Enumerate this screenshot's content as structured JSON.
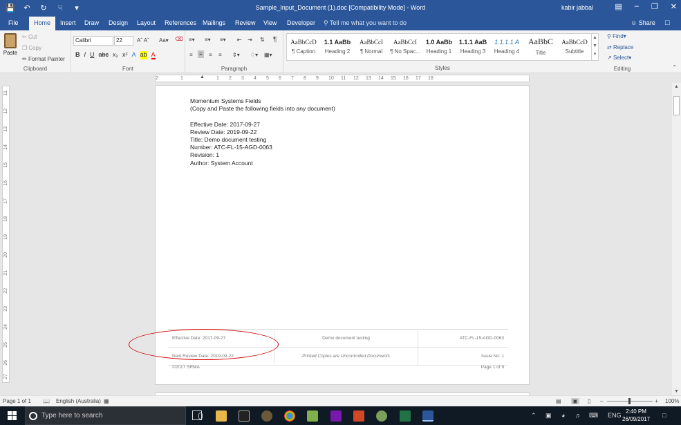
{
  "window": {
    "title": "Sample_Input_Document (1).doc [Compatibility Mode] - Word",
    "user": "kabir jabbal",
    "qat_icons": [
      "save-icon",
      "undo-icon",
      "redo-icon",
      "touch-mode-icon",
      "customize-icon"
    ]
  },
  "tabs": [
    {
      "label": "File"
    },
    {
      "label": "Home"
    },
    {
      "label": "Insert"
    },
    {
      "label": "Draw"
    },
    {
      "label": "Design"
    },
    {
      "label": "Layout"
    },
    {
      "label": "References"
    },
    {
      "label": "Mailings"
    },
    {
      "label": "Review"
    },
    {
      "label": "View"
    },
    {
      "label": "Developer"
    }
  ],
  "active_tab": "Home",
  "tell_me": "Tell me what you want to do",
  "share": "Share",
  "ribbon": {
    "clipboard": {
      "paste": "Paste",
      "cut": "Cut",
      "copy": "Copy",
      "format_painter": "Format Painter",
      "group": "Clipboard"
    },
    "font": {
      "name": "Calibri",
      "size": "22",
      "group": "Font",
      "buttons": [
        "B",
        "I",
        "U",
        "abc",
        "x₂",
        "x²"
      ]
    },
    "paragraph": {
      "group": "Paragraph",
      "pilcrow": "¶"
    },
    "styles": {
      "group": "Styles",
      "items": [
        {
          "preview": "AaBbCcD",
          "label": "¶ Caption"
        },
        {
          "preview": "1.1 AaBb",
          "label": "Heading 2"
        },
        {
          "preview": "AaBbCcI",
          "label": "¶ Normal"
        },
        {
          "preview": "AaBbCcI",
          "label": "¶ No Spac..."
        },
        {
          "preview": "1.0 AaBb",
          "label": "Heading 1"
        },
        {
          "preview": "1.1.1 AaB",
          "label": "Heading 3"
        },
        {
          "preview": "1.1.1.1 A",
          "label": "Heading 4"
        },
        {
          "preview": "AaBbC",
          "label": "Title"
        },
        {
          "preview": "AaBbCcD",
          "label": "Subtitle"
        }
      ]
    },
    "editing": {
      "find": "Find",
      "replace": "Replace",
      "select": "Select",
      "group": "Editing"
    }
  },
  "ruler": {
    "h_ticks": [
      "2",
      "1",
      "1",
      "2",
      "3",
      "4",
      "5",
      "6",
      "7",
      "8",
      "9",
      "10",
      "11",
      "12",
      "13",
      "14",
      "15",
      "16",
      "17",
      "18"
    ],
    "v_ticks": [
      "11",
      "12",
      "13",
      "14",
      "15",
      "16",
      "17",
      "18",
      "19",
      "20",
      "21",
      "22",
      "23",
      "24",
      "25",
      "26",
      "27"
    ]
  },
  "document": {
    "lines": [
      "Momentum Systems Fields",
      "(Copy and Paste the following fields into any document)",
      "",
      "Effective Date: 2017-09-27",
      "Review Date: 2019-09-22",
      "Title: Demo document testing",
      "Number: ATC-FL-15-AGD-0063",
      "Revision: 1",
      "Author: System Account"
    ],
    "footer": {
      "effective": "Effective Date: 2017-09-27",
      "title": "Demo document testing",
      "number": "ATC-FL-15-AGD-0063",
      "next_review": "Next Review Date: 2019-09-22",
      "printed": "Printed Copies are Uncontrolled Documents",
      "issue": "Issue No: 1",
      "copyright": "©2017 SRMA",
      "page": "Page 1 of 9"
    }
  },
  "status": {
    "page": "Page 1 of 1",
    "language": "English (Australia)",
    "zoom": "100%"
  },
  "taskbar": {
    "search_placeholder": "Type here to search",
    "apps": [
      "file-explorer-icon",
      "terminal-icon",
      "settings-icon",
      "chrome-icon",
      "notepadplusplus-icon",
      "onenote-icon",
      "powerpoint-icon",
      "network-icon",
      "excel-icon",
      "word-icon"
    ],
    "language": "ENG",
    "time": "2:40 PM",
    "date": "26/09/2017"
  },
  "colors": {
    "accent": "#2b579a",
    "annotation": "#d40000",
    "taskbar": "#101a24"
  }
}
